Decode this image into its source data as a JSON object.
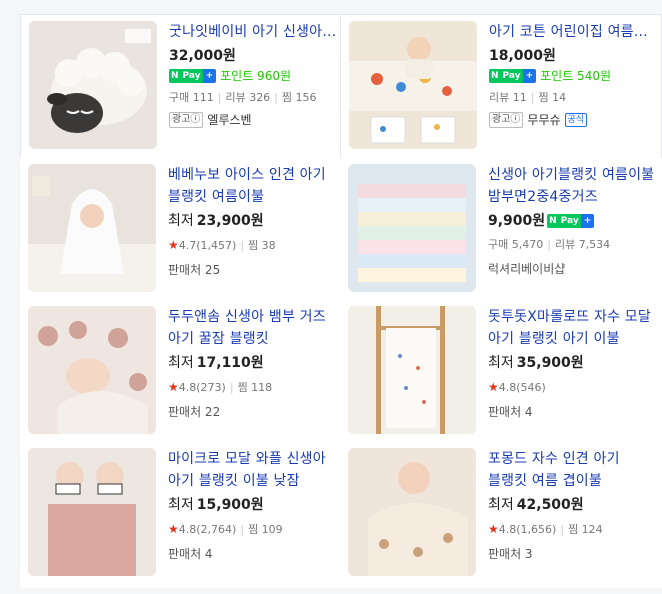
{
  "products": [
    {
      "title": "굿나잇베이비 아기 신생아 블랭킷",
      "price": "32,000원",
      "npay_text": "포인트 960원",
      "stats": [
        "구매 111",
        "리뷰 326",
        "찜 156"
      ],
      "ad_label": "광고ⓘ",
      "seller": "엘루스벤"
    },
    {
      "title": "아기 코튼 어린이집 여름이불",
      "price": "18,000원",
      "npay_text": "포인트 540원",
      "stats": [
        "리뷰 11",
        "찜 14"
      ],
      "ad_label": "광고ⓘ",
      "seller": "무무슈",
      "official": "공식"
    },
    {
      "title": "베베누보 아이스 인견 아기 블랭킷 여름이불",
      "price_label": "최저",
      "price": "23,900원",
      "rating": "4.7(1,457)",
      "zzim": "찜 38",
      "seller_count": "판매처 25"
    },
    {
      "title": "신생아 아기블랭킷 여름이불 밤부면2중4중거즈",
      "price": "9,900원",
      "stats": [
        "구매 5,470",
        "리뷰 7,534"
      ],
      "seller": "럭셔리베이비샵"
    },
    {
      "title": "두두앤솜 신생아 뱀부 거즈 아기 꿀잠 블랭킷",
      "price_label": "최저",
      "price": "17,110원",
      "rating": "4.8(273)",
      "zzim": "찜 118",
      "seller_count": "판매처 22"
    },
    {
      "title": "돗투돗X마롤로뜨 자수 모달 아기 블랭킷 아기 이불",
      "price_label": "최저",
      "price": "35,900원",
      "rating": "4.8(546)",
      "seller_count": "판매처 4"
    },
    {
      "title": "마이크로 모달 와플 신생아 아기 블랭킷 이불 낮잠",
      "price_label": "최저",
      "price": "15,900원",
      "rating": "4.8(2,764)",
      "zzim": "찜 109",
      "seller_count": "판매처 4"
    },
    {
      "title": "포몽드 자수 인견 아기 블랭킷 여름 겹이불",
      "price_label": "최저",
      "price": "42,500원",
      "rating": "4.8(1,656)",
      "zzim": "찜 124",
      "seller_count": "판매처 3"
    }
  ],
  "ui": {
    "npay_n": "N",
    "npay_pay": "Pay",
    "npay_plus": "+",
    "star": "★"
  },
  "colors": {
    "title": "#1a3bb3",
    "npay_green": "#03c75a",
    "star_red": "#e8321c"
  }
}
